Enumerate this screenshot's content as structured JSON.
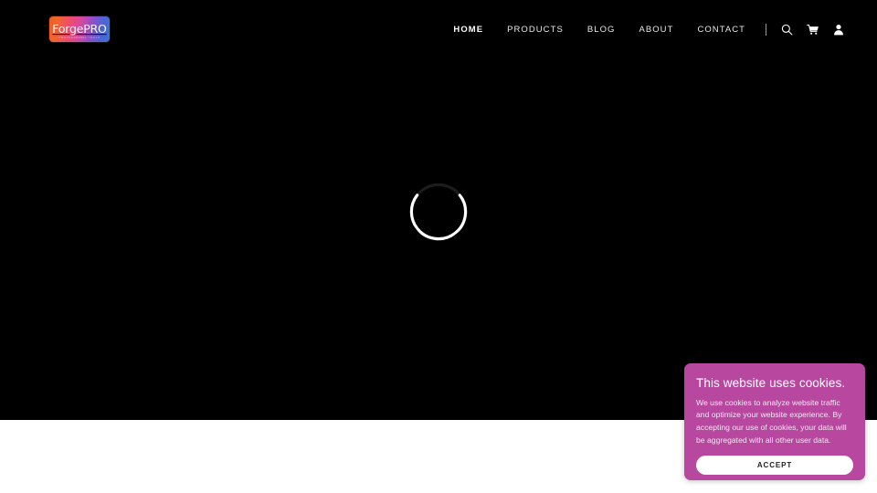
{
  "header": {
    "logo": {
      "text": "ForgePRO",
      "subtext": "PROFESSIONAL TOOLS",
      "gradient_start": "#f05a28",
      "gradient_mid": "#d6489e",
      "gradient_end": "#3f72d6"
    },
    "nav_items": [
      {
        "label": "HOME",
        "active": true
      },
      {
        "label": "PRODUCTS",
        "active": false
      },
      {
        "label": "BLOG",
        "active": false
      },
      {
        "label": "ABOUT",
        "active": false
      },
      {
        "label": "CONTACT",
        "active": false
      }
    ],
    "icons": [
      {
        "name": "search-icon",
        "label": "Search"
      },
      {
        "name": "cart-icon",
        "label": "Cart"
      },
      {
        "name": "account-icon",
        "label": "Account"
      }
    ]
  },
  "hero": {
    "background_color": "#000000",
    "loading": true,
    "spinner_label": "Loading"
  },
  "cookie_banner": {
    "title": "This website uses cookies.",
    "body": "We use cookies to analyze website traffic and optimize your website experience. By accepting our use of cookies, your data will be aggregated with all other user data.",
    "accept_label": "ACCEPT",
    "background_color": "#b8489f",
    "button_color": "#ffffff"
  }
}
